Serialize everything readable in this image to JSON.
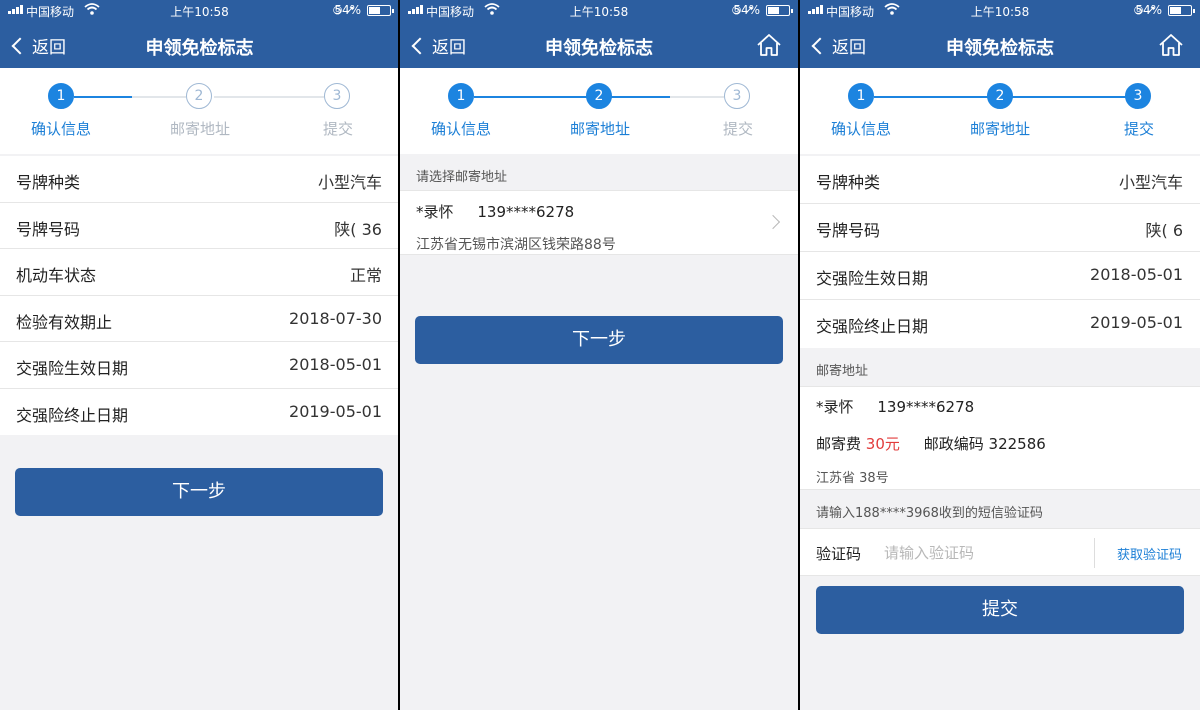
{
  "status": {
    "carrier": "中国移动",
    "time": "上午10:58",
    "battery": "54%",
    "battery_level": 0.54
  },
  "nav": {
    "back": "返回",
    "title": "申领免检标志"
  },
  "steps": [
    "确认信息",
    "邮寄地址",
    "提交"
  ],
  "step_numbers": [
    "1",
    "2",
    "3"
  ],
  "screen1": {
    "rows": [
      {
        "k": "号牌种类",
        "v": "小型汽车"
      },
      {
        "k": "号牌号码",
        "v": "陕(      36"
      },
      {
        "k": "机动车状态",
        "v": "正常"
      },
      {
        "k": "检验有效期止",
        "v": "2018-07-30"
      },
      {
        "k": "交强险生效日期",
        "v": "2018-05-01"
      },
      {
        "k": "交强险终止日期",
        "v": "2019-05-01"
      }
    ],
    "next": "下一步"
  },
  "screen2": {
    "section": "请选择邮寄地址",
    "name": "*录怀",
    "phone": "139****6278",
    "address": "江苏省无锡市滨湖区钱荣路88号",
    "next": "下一步"
  },
  "screen3": {
    "rows": [
      {
        "k": "号牌种类",
        "v": "小型汽车"
      },
      {
        "k": "号牌号码",
        "v": "陕(     6"
      },
      {
        "k": "交强险生效日期",
        "v": "2018-05-01"
      },
      {
        "k": "交强险终止日期",
        "v": "2019-05-01"
      }
    ],
    "section": "邮寄地址",
    "name": "*录怀",
    "phone": "139****6278",
    "fee_label": "邮寄费",
    "fee": "30元",
    "postcode_label": "邮政编码",
    "postcode": "322586",
    "address": "江苏省                 38号",
    "sms_hint": "请输入188****3968收到的短信验证码",
    "code_label": "验证码",
    "code_placeholder": "请输入验证码",
    "get_code": "获取验证码",
    "submit": "提交"
  }
}
